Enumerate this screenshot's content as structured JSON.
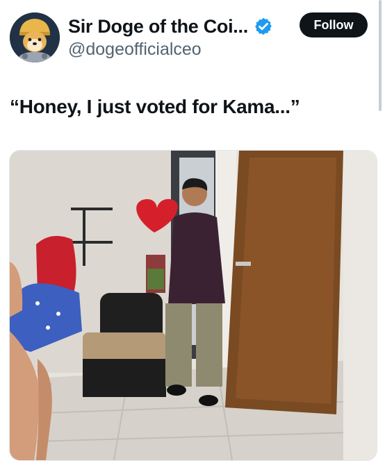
{
  "tweet": {
    "author": {
      "display_name": "Sir Doge of the Coi...",
      "handle": "@dogeofficialceo",
      "verified": true,
      "avatar_icon": "shiba-doge-avatar"
    },
    "follow_label": "Follow",
    "text": "“Honey, I just voted for Kama...”",
    "media_icon": "photo-room-scene"
  },
  "colors": {
    "text": "#0f1419",
    "secondary": "#536471",
    "verified_badge": "#1d9bf0",
    "follow_bg": "#0f1419"
  }
}
